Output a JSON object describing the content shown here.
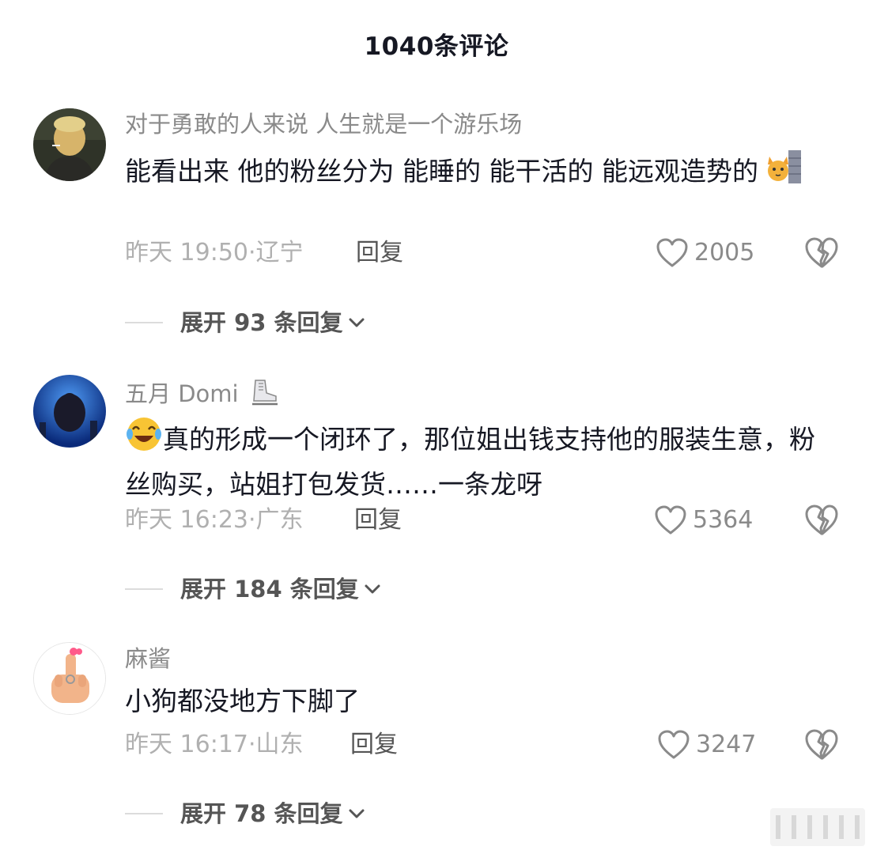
{
  "header": {
    "title": "1040条评论"
  },
  "comments": [
    {
      "username": "对于勇敢的人来说 人生就是一个游乐场",
      "content": "能看出来  他的粉丝分为 能睡的   能干活的  能远观造势的",
      "time": "昨天 19:50",
      "location": "辽宁",
      "reply_label": "回复",
      "likes": "2005",
      "expand_label": "展开 93 条回复",
      "avatar_icon": "avatar-man-smoking-icon",
      "emoji_icon": "cat-peeking-icon"
    },
    {
      "username": "五月 Domi",
      "content": "真的形成一个闭环了，那位姐出钱支持他的服装生意，粉丝购买，站姐打包发货……一条龙呀",
      "time": "昨天 16:23",
      "location": "广东",
      "reply_label": "回复",
      "likes": "5364",
      "expand_label": "展开 184 条回复",
      "avatar_icon": "avatar-concert-icon",
      "emoji_icon": "laughing-crying-face-icon",
      "name_emoji_icon": "ice-skate-icon"
    },
    {
      "username": "麻酱",
      "content": "小狗都没地方下脚了",
      "time": "昨天 16:17",
      "location": "山东",
      "reply_label": "回复",
      "likes": "3247",
      "expand_label": "展开 78 条回复",
      "avatar_icon": "avatar-hand-gesture-icon"
    }
  ],
  "colors": {
    "text_primary": "#161823",
    "text_secondary": "#8a8a8a",
    "text_meta": "#b0b0b0"
  }
}
